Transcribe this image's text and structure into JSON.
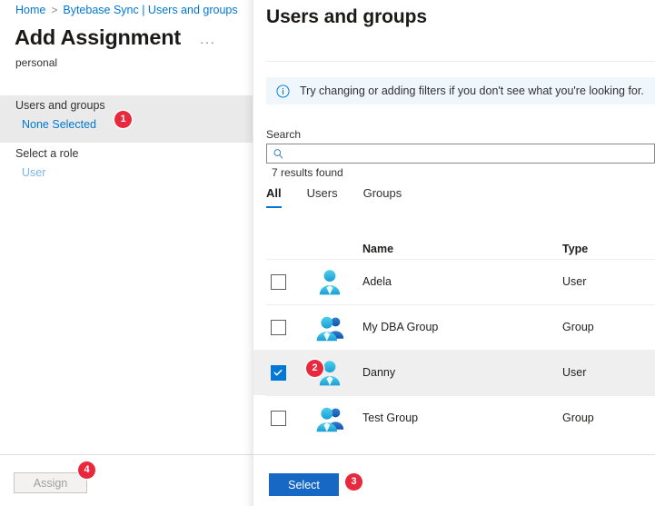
{
  "left_blade": {
    "breadcrumb": {
      "home": "Home",
      "separator": ">",
      "current": "Bytebase Sync | Users and groups"
    },
    "title": "Add Assignment",
    "ellipsis_menu": "···",
    "subtitle": "personal",
    "fields": [
      {
        "label": "Users and groups",
        "value": "None Selected"
      },
      {
        "label": "Select a role",
        "value": "User"
      }
    ],
    "assign_button": "Assign"
  },
  "panel": {
    "title": "Users and groups",
    "info_banner": {
      "icon": "info-icon",
      "text": "Try changing or adding filters if you don't see what you're looking for."
    },
    "search": {
      "label": "Search",
      "value": "",
      "placeholder": "",
      "icon": "search-icon"
    },
    "results_count": "7 results found",
    "tabs": [
      {
        "label": "All",
        "active": true
      },
      {
        "label": "Users",
        "active": false
      },
      {
        "label": "Groups",
        "active": false
      }
    ],
    "table": {
      "headers": {
        "name": "Name",
        "type": "Type"
      },
      "rows": [
        {
          "name": "Adela",
          "type": "User",
          "avatar": "user-avatar-icon",
          "checked": false
        },
        {
          "name": "My DBA Group",
          "type": "Group",
          "avatar": "group-avatar-icon",
          "checked": false
        },
        {
          "name": "Danny",
          "type": "User",
          "avatar": "user-avatar-icon",
          "checked": true
        },
        {
          "name": "Test Group",
          "type": "Group",
          "avatar": "group-avatar-icon",
          "checked": false
        }
      ]
    },
    "select_button": "Select"
  },
  "step_badges": [
    {
      "number": "1"
    },
    {
      "number": "2"
    },
    {
      "number": "3"
    },
    {
      "number": "4"
    }
  ],
  "colors": {
    "accent_blue": "#0078d4",
    "button_blue": "#1668c4",
    "badge_red": "#e8283c",
    "info_banner_bg": "#eff6fc",
    "selected_row_bg": "#efefef",
    "field_highlight_bg": "#eaeaea"
  }
}
